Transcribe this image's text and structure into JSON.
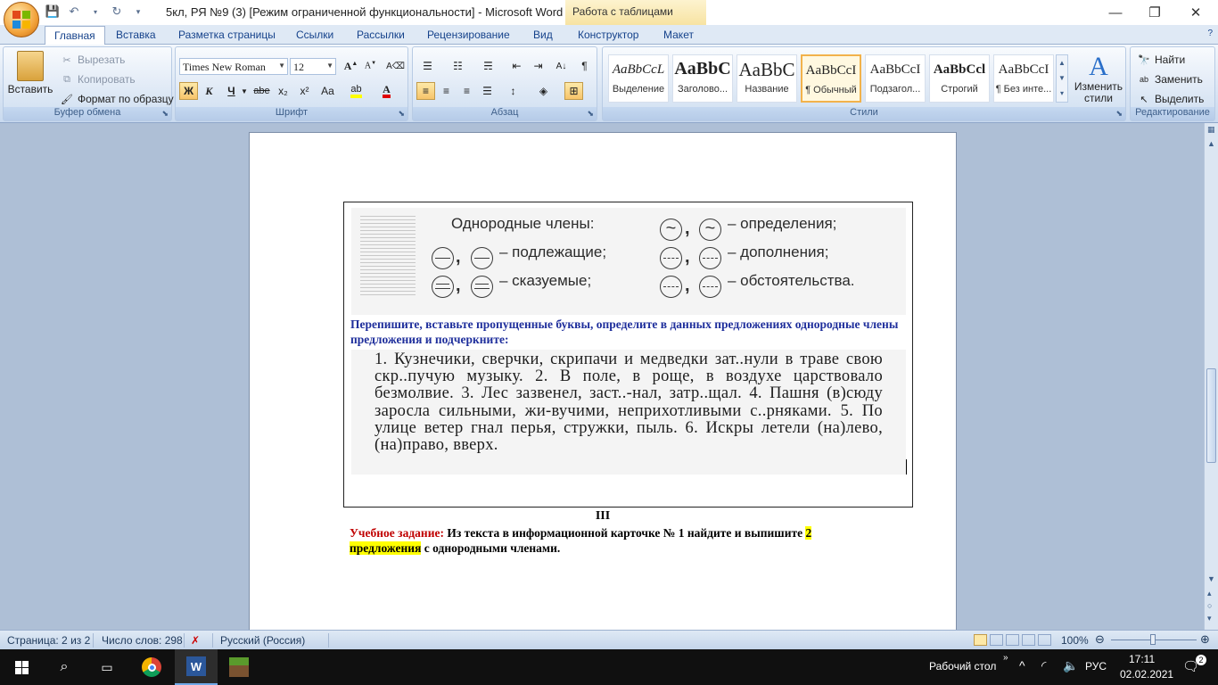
{
  "window": {
    "title": "5кл, РЯ №9 (3) [Режим ограниченной функциональности] - Microsoft Word",
    "contextual_tab": "Работа с таблицами"
  },
  "ribbon": {
    "tabs": [
      "Главная",
      "Вставка",
      "Разметка страницы",
      "Ссылки",
      "Рассылки",
      "Рецензирование",
      "Вид",
      "Конструктор",
      "Макет"
    ],
    "clipboard": {
      "label": "Буфер обмена",
      "paste": "Вставить",
      "cut": "Вырезать",
      "copy": "Копировать",
      "format_painter": "Формат по образцу"
    },
    "font": {
      "label": "Шрифт",
      "name": "Times New Roman",
      "size": "12",
      "bold": "Ж",
      "italic": "К",
      "underline": "Ч",
      "strike": "abe",
      "subscript": "x₂",
      "superscript": "x²",
      "change_case": "Aa"
    },
    "paragraph": {
      "label": "Абзац"
    },
    "styles": {
      "label": "Стили",
      "items": [
        {
          "sample": "AaBbCcL",
          "name": "Выделение"
        },
        {
          "sample": "AaBbC",
          "name": "Заголово..."
        },
        {
          "sample": "AaBbC",
          "name": "Название"
        },
        {
          "sample": "AaBbCcI",
          "name": "¶ Обычный"
        },
        {
          "sample": "AaBbCcI",
          "name": "Подзагол..."
        },
        {
          "sample": "AaBbCcl",
          "name": "Строгий"
        },
        {
          "sample": "AaBbCcI",
          "name": "¶ Без инте..."
        }
      ],
      "change": "Изменить стили"
    },
    "editing": {
      "label": "Редактирование",
      "find": "Найти",
      "replace": "Заменить",
      "select": "Выделить"
    }
  },
  "document": {
    "legend": {
      "title": "Однородные  члены:",
      "definitions": "– определения;",
      "subjects": "– подлежащие;",
      "objects": "– дополнения;",
      "predicates": "– сказуемые;",
      "adverbials": "– обстоятельства."
    },
    "task1": "Перепишите, вставьте пропущенные буквы, определите  в данных предложениях однородные члены предложения и подчеркните:",
    "exercise": "1. Кузнечики, сверчки, скрипачи и медведки зат..нули в траве свою скр..пучую музыку. 2. В поле, в роще, в воздухе царствовало безмолвие. 3. Лес зазвенел, заст..-нал, затр..щал. 4. Пашня (в)сюду заросла сильными, жи-вучими, неприхотливыми с..рняками. 5. По улице ветер гнал перья, стружки, пыль. 6. Искры летели (на)лево, (на)право, вверх.",
    "heading": "III",
    "task2_label": "Учебное задание:",
    "task2_text": " Из текста в информационной карточке № 1  найдите и выпишите ",
    "task2_highlight": "2 предложения",
    "task2_end": " с однородными членами."
  },
  "statusbar": {
    "page": "Страница: 2 из 2",
    "words": "Число слов: 298",
    "language": "Русский (Россия)",
    "zoom": "100%"
  },
  "taskbar": {
    "desktop": "Рабочий стол",
    "lang": "РУС",
    "time": "17:11",
    "date": "02.02.2021",
    "notifications": "2"
  }
}
